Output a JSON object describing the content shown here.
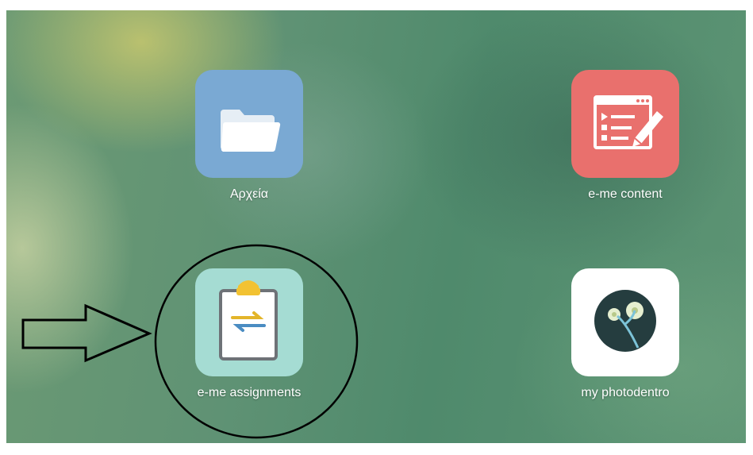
{
  "desktop": {
    "apps": [
      {
        "label": "Αρχεία",
        "icon": "folder-icon",
        "tile_color": "#7aa9d3"
      },
      {
        "label": "e-me content",
        "icon": "content-editor-icon",
        "tile_color": "#e9706d"
      },
      {
        "label": "e-me assignments",
        "icon": "clipboard-assignment-icon",
        "tile_color": "#a5dcd3"
      },
      {
        "label": "my photodentro",
        "icon": "photodentro-icon",
        "tile_color": "#ffffff"
      }
    ]
  },
  "annotations": {
    "arrow": "right-arrow-annotation",
    "circle": "highlight-circle-annotation"
  }
}
